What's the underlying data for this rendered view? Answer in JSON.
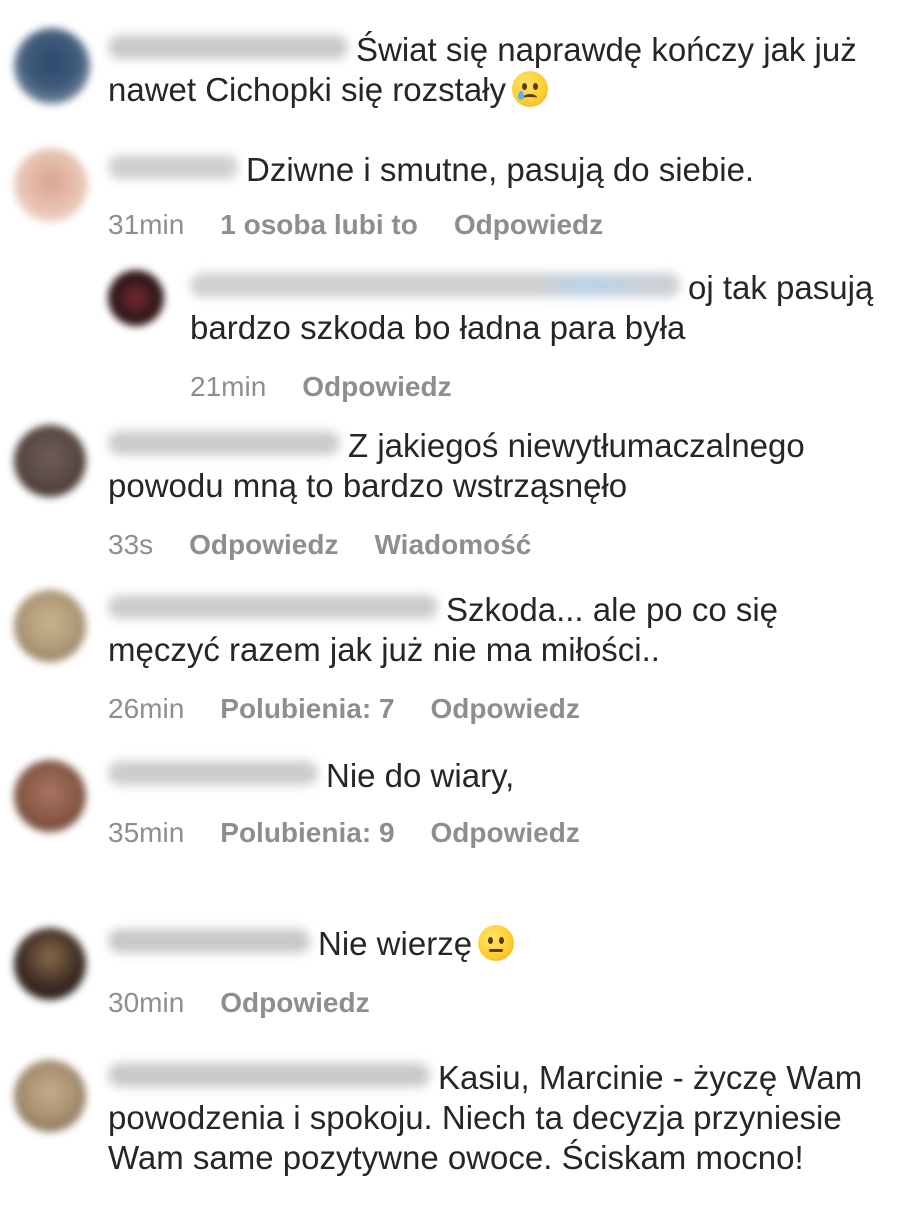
{
  "comments": [
    {
      "text": "Świat się naprawdę kończy jak już nawet Cichopki się rozstały",
      "emoji": "crying-face-emoji",
      "avatar_color": "#3f5a78",
      "meta": {}
    },
    {
      "text": "Dziwne i smutne, pasują do siebie.",
      "avatar_color": "#e2b9a6",
      "meta": {
        "time": "31min",
        "likes": "1 osoba lubi to",
        "reply": "Odpowiedz"
      }
    },
    {
      "text": "oj tak pasują bardzo szkoda bo ładna para była",
      "avatar_color": "#3a1a1c",
      "is_reply": true,
      "meta": {
        "time": "21min",
        "reply": "Odpowiedz"
      }
    },
    {
      "text": "Z jakiegoś niewytłumaczalnego powodu mną to bardzo wstrząsnęło",
      "avatar_color": "#5a4a44",
      "meta": {
        "time": "33s",
        "reply": "Odpowiedz",
        "message": "Wiadomość"
      }
    },
    {
      "text": "Szkoda... ale po co się męczyć razem jak już nie ma miłości..",
      "avatar_color": "#b09a78",
      "meta": {
        "time": "26min",
        "likes": "Polubienia: 7",
        "reply": "Odpowiedz"
      }
    },
    {
      "text": "Nie do wiary,",
      "avatar_color": "#8a5a46",
      "meta": {
        "time": "35min",
        "likes": "Polubienia: 9",
        "reply": "Odpowiedz"
      }
    },
    {
      "text": "Nie wierzę",
      "emoji": "neutral-face-emoji",
      "avatar_color": "#3a2a22",
      "meta": {
        "time": "30min",
        "reply": "Odpowiedz"
      }
    },
    {
      "text": "Kasiu, Marcinie - życzę Wam powodzenia i spokoju. Niech ta decyzja przyniesie Wam same pozytywne owoce. Ściskam mocno!",
      "avatar_color": "#a89070",
      "meta": {}
    }
  ],
  "colors": {
    "text": "#262626",
    "meta": "#8e8e8e",
    "background": "#ffffff"
  }
}
